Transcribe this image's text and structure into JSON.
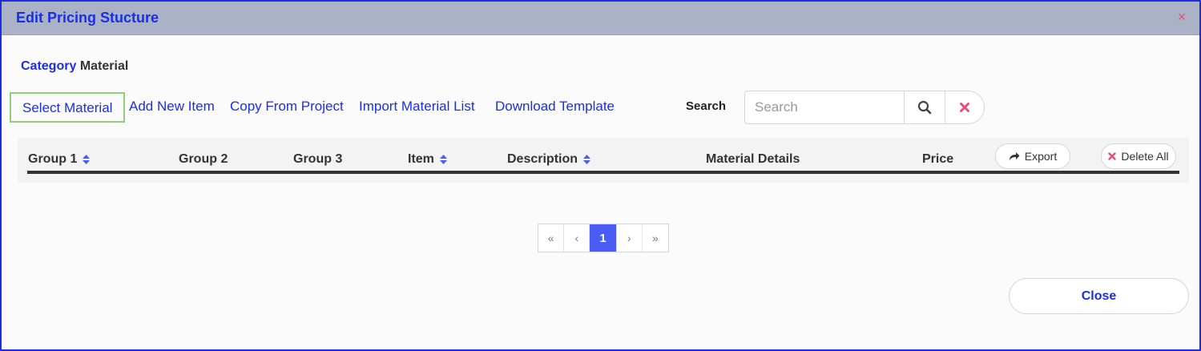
{
  "modal": {
    "title": "Edit Pricing Stucture",
    "close_glyph": "×"
  },
  "category": {
    "label": "Category",
    "value": "Material"
  },
  "actions": [
    {
      "label": "Select Material",
      "selected": true
    },
    {
      "label": "Add New Item"
    },
    {
      "label": "Copy From Project"
    },
    {
      "label": "Import Material List"
    },
    {
      "label": "Download Template"
    }
  ],
  "search": {
    "label": "Search",
    "placeholder": "Search",
    "value": "",
    "search_icon": "magnifier-icon",
    "clear_icon": "x-icon"
  },
  "table": {
    "columns": [
      {
        "label": "Group 1",
        "sortable": true
      },
      {
        "label": "Group 2",
        "sortable": false
      },
      {
        "label": "Group 3",
        "sortable": false
      },
      {
        "label": "Item",
        "sortable": true
      },
      {
        "label": "Description",
        "sortable": true
      },
      {
        "label": "Material Details",
        "sortable": false
      },
      {
        "label": "Price",
        "sortable": false
      }
    ],
    "export_label": "Export",
    "delete_all_label": "Delete All",
    "rows": []
  },
  "pagination": {
    "first": "«",
    "prev": "‹",
    "current": "1",
    "next": "›",
    "last": "»"
  },
  "footer": {
    "close_label": "Close"
  },
  "colors": {
    "accent": "#1a2ee8",
    "header_bg": "#aab2c6",
    "active_page": "#4a5cf5",
    "danger": "#e6507a",
    "selected_outline": "#8fd07a"
  }
}
